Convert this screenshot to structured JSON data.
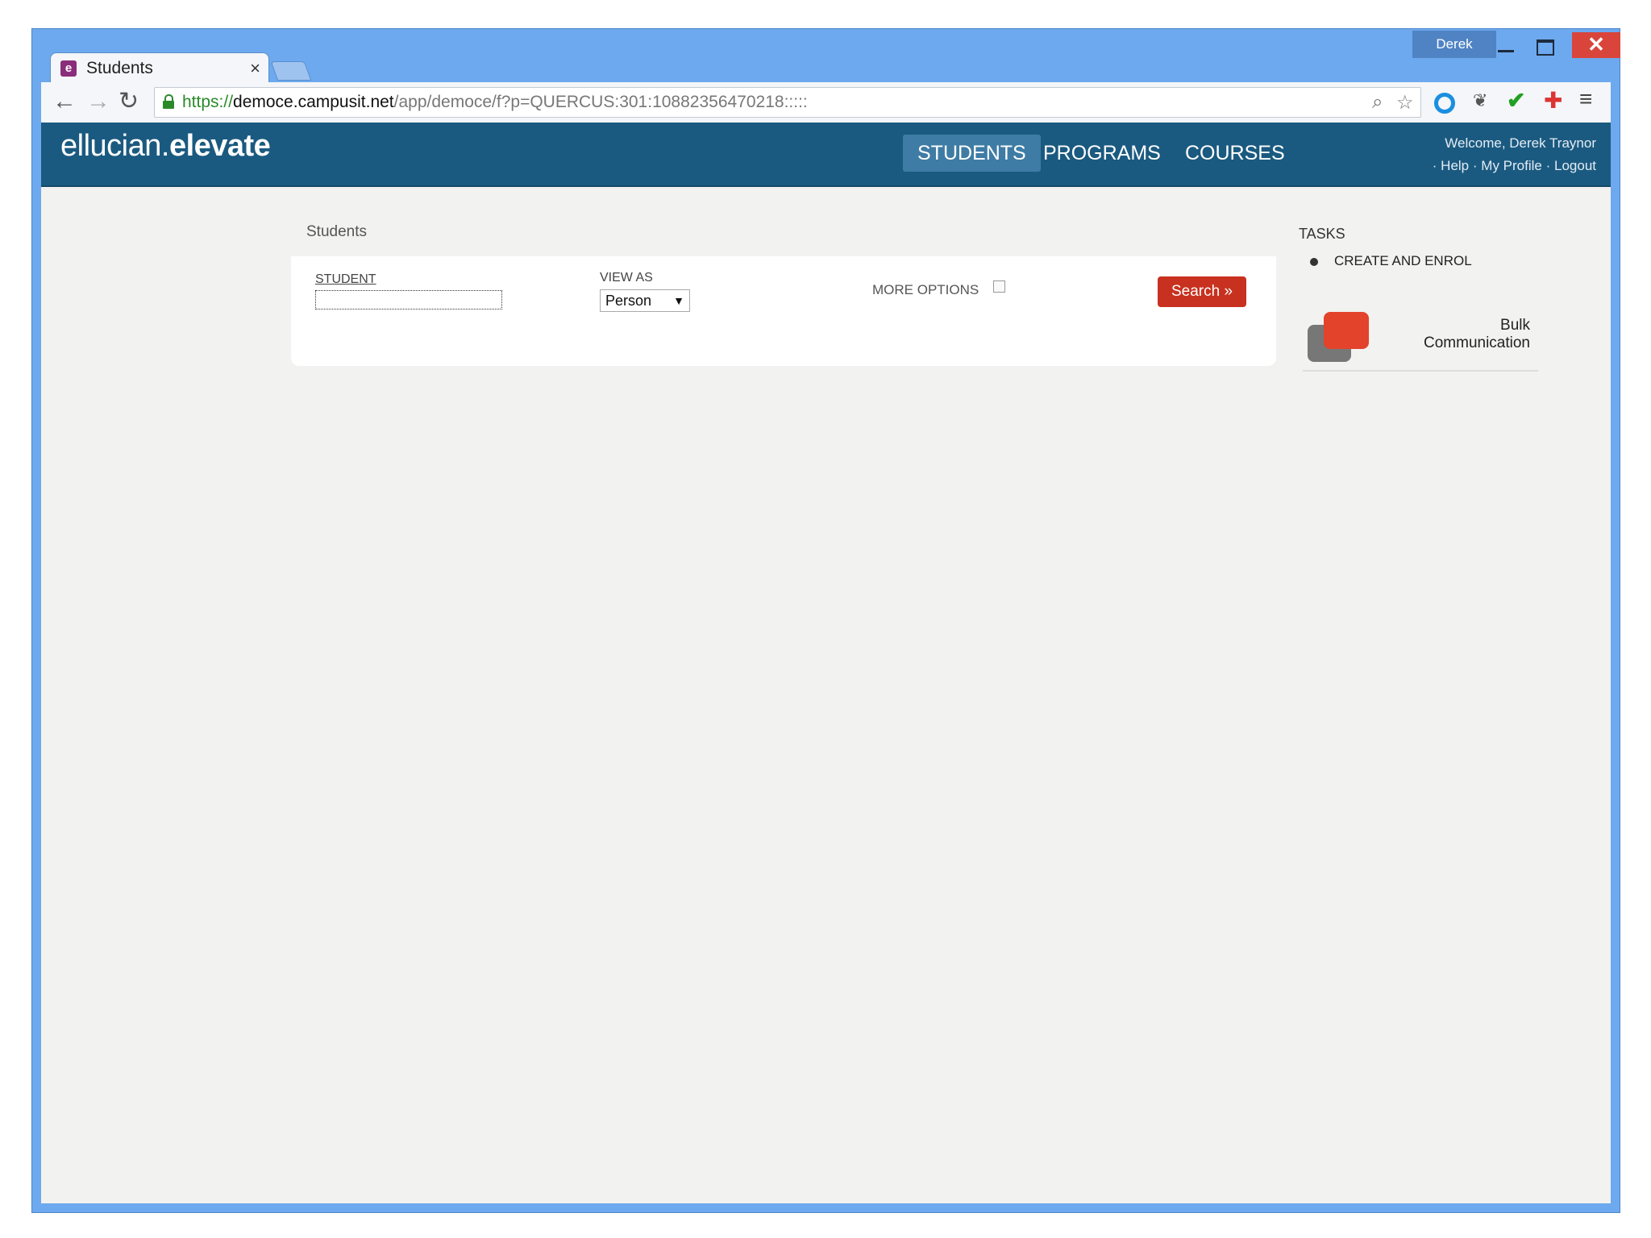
{
  "browser": {
    "user_badge": "Derek",
    "close_glyph": "✕",
    "tab": {
      "favicon": "e",
      "title": "Students",
      "close": "×"
    },
    "nav": {
      "back": "←",
      "forward": "→",
      "reload": "↻"
    },
    "url": {
      "scheme": "https://",
      "host": "democe.campusit.net",
      "path": "/app/democe/f?p=QUERCUS:301:10882356470218:::::"
    },
    "icons": {
      "zoom": "⌕",
      "star": "☆",
      "evernote": "❦",
      "check": "✔",
      "plus": "✚",
      "menu": "≡"
    }
  },
  "app": {
    "logo_light": "ellucian",
    "logo_dot": ".",
    "logo_bold": "elevate",
    "nav": [
      {
        "label": "STUDENTS",
        "active": true
      },
      {
        "label": "PROGRAMS",
        "active": false
      },
      {
        "label": "COURSES",
        "active": false
      }
    ],
    "welcome": "Welcome, Derek Traynor",
    "links": {
      "help": "Help",
      "profile": "My Profile",
      "logout": "Logout",
      "sep": "·"
    }
  },
  "page": {
    "breadcrumb": "Students",
    "search": {
      "student_label": "STUDENT",
      "student_value": "",
      "view_as_label": "VIEW AS",
      "view_as_value": "Person",
      "more_options_label": "MORE OPTIONS",
      "more_options_checked": false,
      "search_button": "Search »"
    }
  },
  "tasks": {
    "title": "TASKS",
    "items": [
      "CREATE AND ENROL"
    ],
    "bulk_line1": "Bulk",
    "bulk_line2": "Communication"
  },
  "colors": {
    "header": "#1b5a80",
    "active_nav": "#3e7ca5",
    "search_button": "#c8311f",
    "window_frame": "#6da9ee"
  }
}
